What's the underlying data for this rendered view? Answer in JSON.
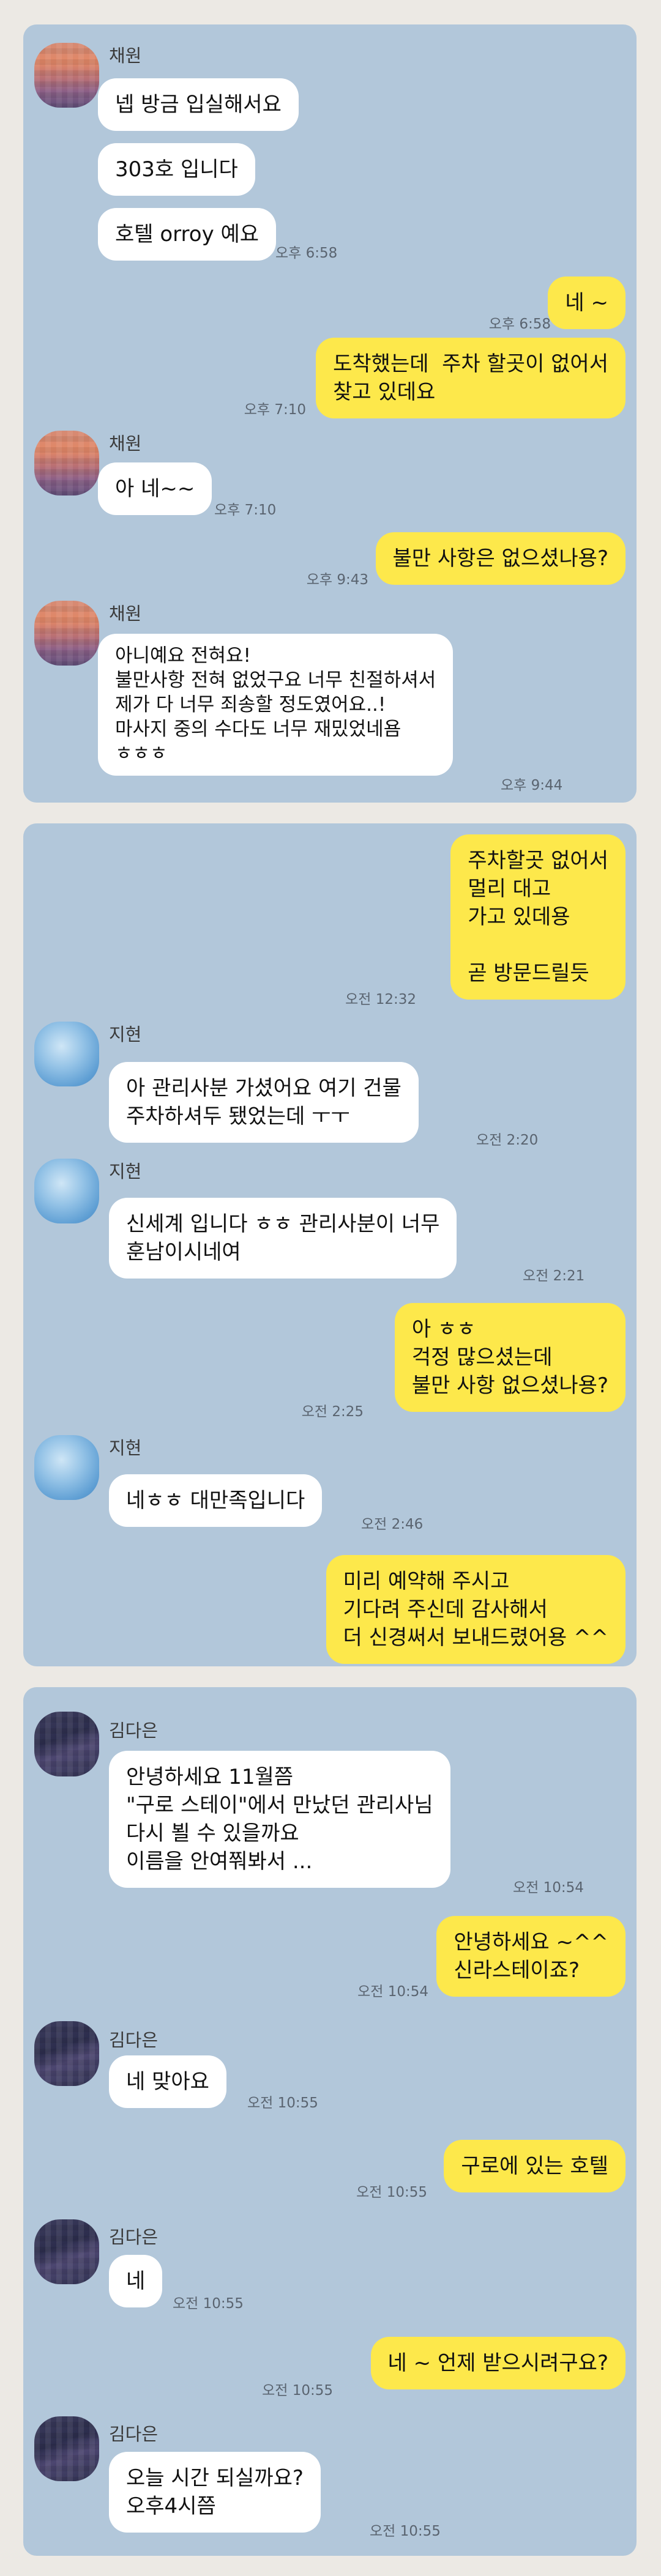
{
  "chat1": {
    "sender": "채원",
    "m1": "넵 방금 입실해서요",
    "m2": "303호 입니다",
    "m3": "호텔 orroy 예요",
    "t3": "오후 6:58",
    "m4": "네 ~",
    "t4": "오후 6:58",
    "m5": "도착했는데  주차 할곳이 없어서\n찾고 있데요",
    "t5": "오후 7:10",
    "m6": "아 네~~",
    "t6": "오후 7:10",
    "m7": "불만 사항은 없으셨나용?",
    "t7": "오후 9:43",
    "m8": "아니예요 전혀요!\n불만사항 전혀 없었구요 너무 친절하셔서\n제가 다 너무 죄송할 정도였어요..!\n마사지 중의 수다도 너무 재밌었네욤\nㅎㅎㅎ",
    "t8": "오후 9:44"
  },
  "chat2": {
    "sender": "지현",
    "m1": "주차할곳 없어서\n멀리 대고\n가고 있데용\n\n곧 방문드릴듯",
    "t1": "오전 12:32",
    "m2": "아 관리사분 가셨어요 여기 건물\n주차하셔두 됐었는데 ㅜㅜ",
    "t2": "오전 2:20",
    "m3": "신세계 입니다 ㅎㅎ 관리사분이 너무\n훈남이시네여",
    "t3": "오전 2:21",
    "m4": "아 ㅎㅎ\n걱정 많으셨는데\n불만 사항 없으셨나용?",
    "t4": "오전 2:25",
    "m5": "네ㅎㅎ 대만족입니다",
    "t5": "오전 2:46",
    "m6": "미리 예약해 주시고\n기다려 주신데 감사해서\n더 신경써서 보내드렸어용 ^^"
  },
  "chat3": {
    "sender": "김다은",
    "m1": "안녕하세요 11월쯤\n\"구로 스테이\"에서 만났던 관리사님\n다시 뵐 수 있을까요\n이름을 안여쭤봐서 ...",
    "t1": "오전 10:54",
    "m2": "안녕하세요 ~^^\n신라스테이죠?",
    "t2": "오전 10:54",
    "m3": "네 맞아요",
    "t3": "오전 10:55",
    "m4": "구로에 있는 호텔",
    "t4": "오전 10:55",
    "m5": "네",
    "t5": "오전 10:55",
    "m6": "네 ~ 언제 받으시려구요?",
    "t6": "오전 10:55",
    "m7": "오늘 시간 되실까요?\n오후4시쯤",
    "t7": "오전 10:55"
  }
}
